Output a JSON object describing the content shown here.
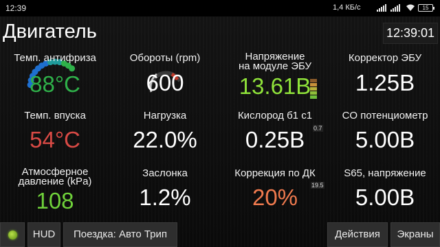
{
  "statusbar": {
    "time": "12:39",
    "net_speed": "1,4 КБ/с",
    "battery": "15",
    "icons": [
      "signal-icon",
      "signal-icon",
      "wifi-icon",
      "battery-icon"
    ]
  },
  "header": {
    "title": "Двигатель",
    "clock": "12:39:01"
  },
  "gauges": {
    "coolant": {
      "label": "Темп. антифриза",
      "value": "88°C",
      "color": "#2fb14a"
    },
    "rpm": {
      "label": "Обороты (rpm)",
      "value": "600",
      "color": "#ffffff"
    },
    "voltage": {
      "label_line1": "Напряжение",
      "label_line2": "на модуле ЭБУ",
      "value": "13.61В",
      "color": "#8fe23a"
    },
    "ecu_trim": {
      "label": "Корректор ЭБУ",
      "value": "1.25В",
      "color": "#ffffff"
    },
    "intake": {
      "label": "Темп. впуска",
      "value": "54°C",
      "color": "#d94a45"
    },
    "load": {
      "label": "Нагрузка",
      "value": "22.0%",
      "color": "#ffffff"
    },
    "o2": {
      "label": "Кислород б1 с1",
      "value": "0.25В",
      "color": "#ffffff",
      "small": "0.7"
    },
    "co_pot": {
      "label": "CO потенциометр",
      "value": "5.00В",
      "color": "#ffffff"
    },
    "baro": {
      "label_line1": "Атмосферное",
      "label_line2": "давление (kPa)",
      "value": "108",
      "color": "#6fd13a"
    },
    "throttle": {
      "label": "Заслонка",
      "value": "1.2%",
      "color": "#ffffff"
    },
    "fuel_trim": {
      "label": "Коррекция по ДК",
      "value": "20%",
      "color": "#f07a4e",
      "small": "19.5"
    },
    "s65": {
      "label": "S65, напряжение",
      "value": "5.00В",
      "color": "#ffffff"
    }
  },
  "toolbar": {
    "led_color": "#8bc34a",
    "hud_label": "HUD",
    "trip_label": "Поездка: Авто Трип",
    "actions_label": "Действия",
    "screens_label": "Экраны"
  }
}
